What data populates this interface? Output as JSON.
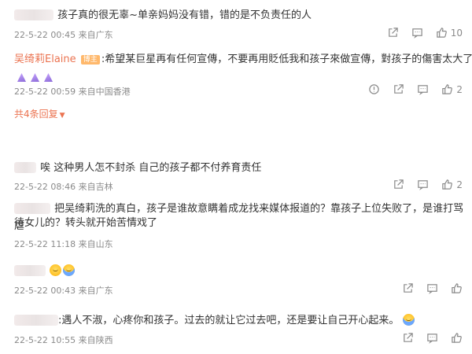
{
  "comments": [
    {
      "text": "孩子真的很无辜~单亲妈妈没有错，错的是不负责任的人",
      "meta": "22-5-22 00:45 来自广东",
      "likes": "10"
    },
    {
      "author": "吴绮莉Elaine",
      "badge": "博主",
      "text": ":希望某巨星再有任何宣傳，不要再用貶低我和孩子來做宣傳，對孩子的傷害太大了。",
      "meta": "22-5-22 00:59 来自中国香港",
      "likes": "2",
      "replies_label": "共4条回复"
    },
    {
      "text": "唉 这种男人怎不封杀 自己的孩子都不付养育责任",
      "meta": "22-5-22 08:46 来自吉林",
      "likes": "2"
    },
    {
      "text_line1": "把吴绮莉洗的真白，孩子是谁故意瞒着成龙找来媒体报道的？靠孩子上位失败了，是谁打骂虐",
      "text_line2": "待女儿的？转头就开始苦情戏了",
      "meta": "22-5-22 11:18 来自山东"
    },
    {
      "meta": "22-5-22 00:43 来自广东"
    },
    {
      "text": ":遇人不淑，心疼你和孩子。过去的就让它过去吧，还是要让自己开心起来。",
      "meta": "22-5-22 10:55 来自陕西"
    }
  ],
  "icons": {
    "share": "share-icon",
    "comment": "comment-icon",
    "like": "thumbs-up-icon",
    "report": "report-icon"
  },
  "colors": {
    "accent": "#eb7350",
    "meta": "#8a8a8a"
  }
}
